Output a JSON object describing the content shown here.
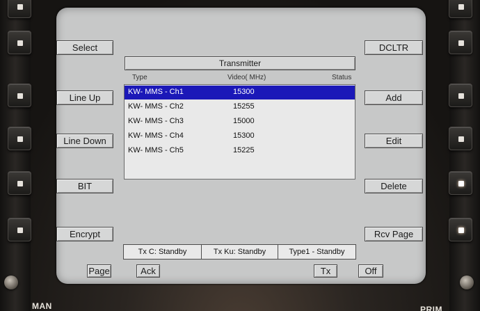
{
  "bezel": {
    "bottom_left_label": "MAN",
    "bottom_right_label": "PRIM"
  },
  "left_buttons": [
    "Select",
    "Line Up",
    "Line Down",
    "BIT",
    "Encrypt"
  ],
  "right_buttons": [
    "DCLTR",
    "Add",
    "Edit",
    "Delete",
    "Rcv Page"
  ],
  "transmitter": {
    "title": "Transmitter",
    "columns": {
      "type": "Type",
      "video": "Video( MHz)",
      "status": "Status"
    },
    "rows": [
      {
        "type": "KW- MMS - Ch1",
        "video": "15300",
        "selected": true
      },
      {
        "type": "KW- MMS - Ch2",
        "video": "15255",
        "selected": false
      },
      {
        "type": "KW- MMS - Ch3",
        "video": "15000",
        "selected": false
      },
      {
        "type": "KW- MMS - Ch4",
        "video": "15300",
        "selected": false
      },
      {
        "type": "KW- MMS - Ch5",
        "video": "15225",
        "selected": false
      }
    ]
  },
  "status_bar": [
    "Tx C: Standby",
    "Tx Ku: Standby",
    "Type1 - Standby"
  ],
  "bottom_buttons": {
    "page": "Page",
    "ack": "Ack",
    "tx": "Tx",
    "off": "Off"
  },
  "colors": {
    "screen": "#c7c8c8",
    "selection": "#1b18b8",
    "list_bg": "#e9e9e9"
  }
}
